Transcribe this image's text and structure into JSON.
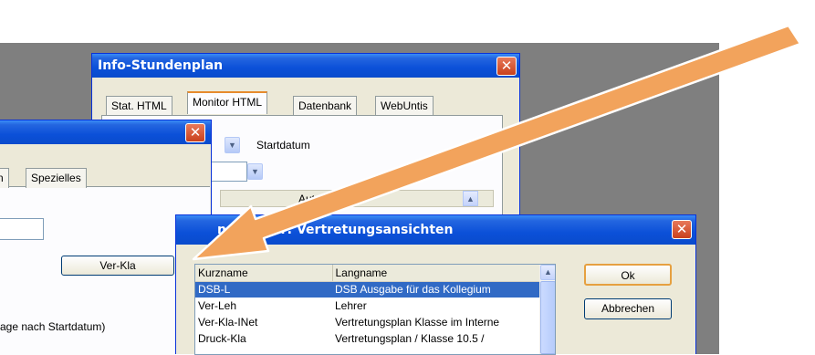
{
  "info_window": {
    "title": "Info-Stundenplan",
    "close_label": "✕",
    "tabs": [
      "Stat. HTML",
      "Monitor HTML",
      "Datenbank",
      "WebUntis"
    ],
    "startdatum_label": "Startdatum",
    "column_header": "AutoInfo"
  },
  "back_window": {
    "close_label": "✕",
    "tab_partial": "n",
    "tab_label": "Spezielles",
    "button_label": "Ver-Kla",
    "bottom_text": "age nach Startdatum)"
  },
  "dialog": {
    "title": "n / Lehrer: Vertretungsansichten",
    "close_label": "✕",
    "columns": [
      "Kurzname",
      "Langname"
    ],
    "rows": [
      {
        "kurz": "DSB-L",
        "lang": "DSB Ausgabe für das Kollegium",
        "selected": true
      },
      {
        "kurz": "Ver-Leh",
        "lang": "Lehrer",
        "selected": false
      },
      {
        "kurz": "Ver-Kla-INet",
        "lang": "Vertretungsplan  Klasse im Interne",
        "selected": false
      },
      {
        "kurz": "Druck-Kla",
        "lang": "Vertretungsplan / Klasse  10.5  /",
        "selected": false
      }
    ],
    "ok_label": "Ok",
    "cancel_label": "Abbrechen"
  },
  "icons": {
    "arrow": "orange-arrow-icon",
    "combo": "chevron-down-icon",
    "scroll_up": "chevron-up-icon"
  },
  "colors": {
    "arrow": "#f2a35c",
    "titlebar": "#0a4bcc",
    "selection": "#316ac5",
    "close": "#c9401c"
  }
}
